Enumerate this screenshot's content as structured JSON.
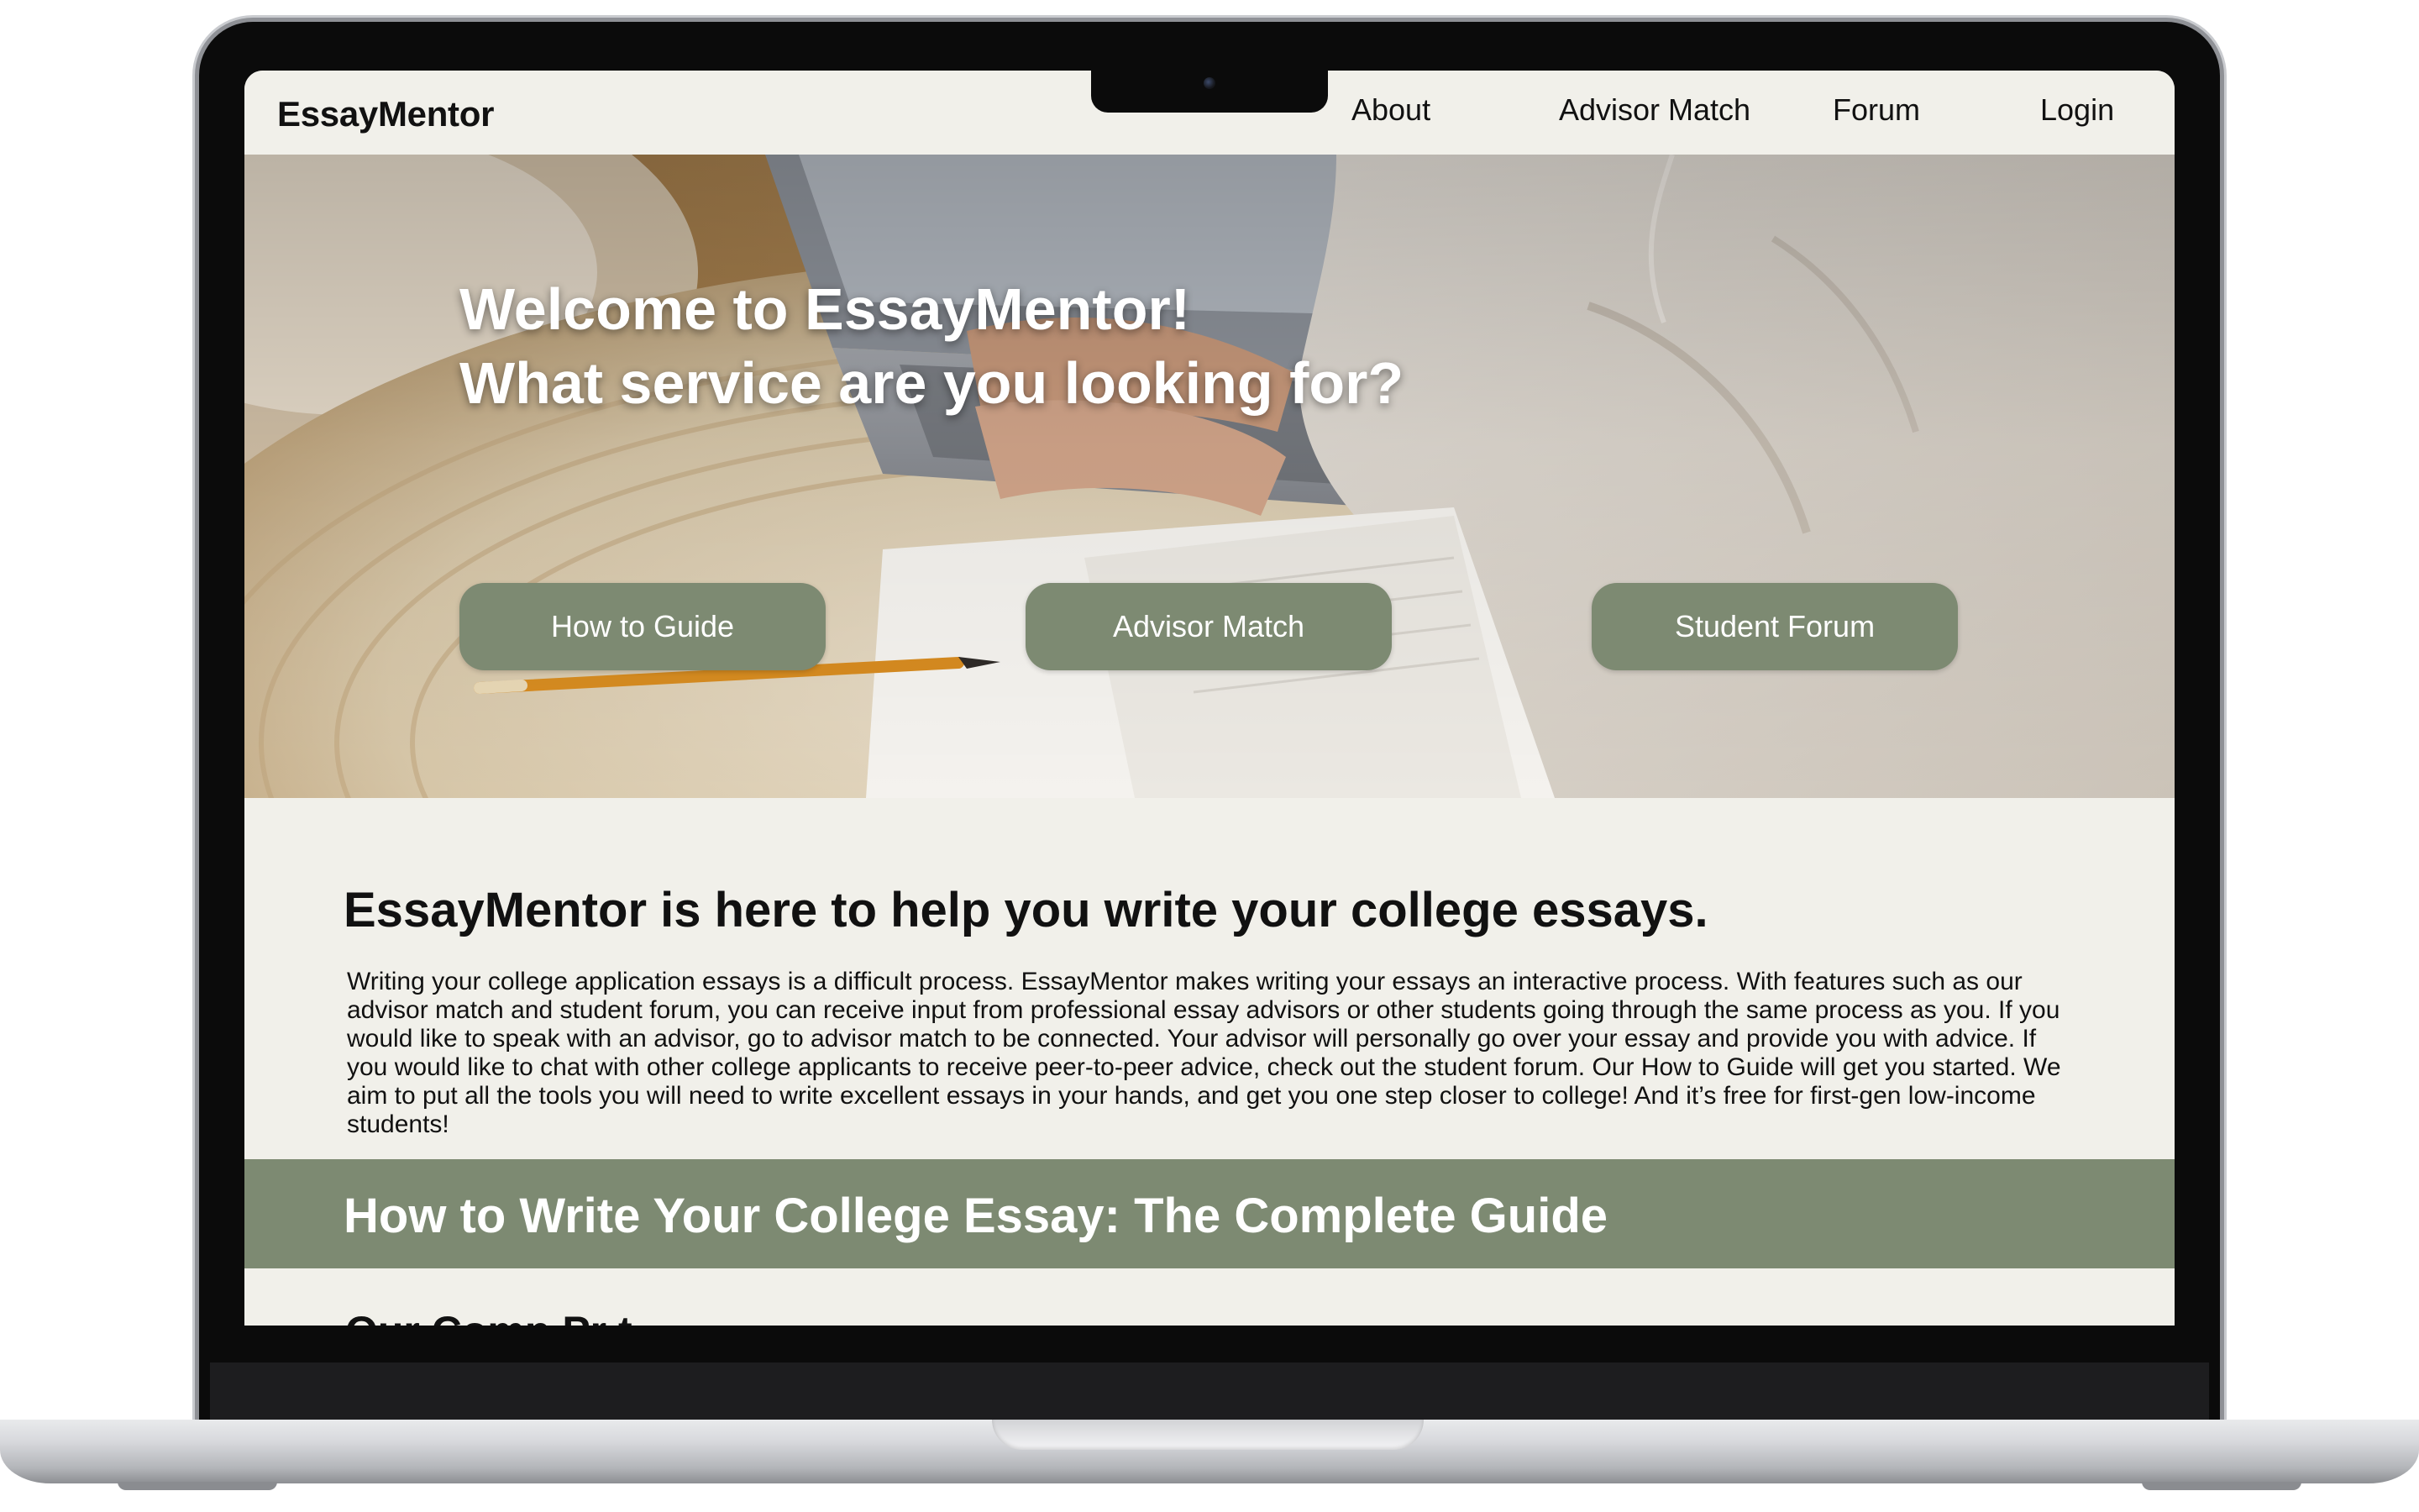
{
  "nav": {
    "brand": "EssayMentor",
    "links": [
      {
        "label": "About"
      },
      {
        "label": "Advisor Match"
      },
      {
        "label": "Forum"
      },
      {
        "label": "Login"
      }
    ]
  },
  "hero": {
    "title_line1": "Welcome to EssayMentor!",
    "title_line2": "What service are you looking for?",
    "buttons": [
      {
        "label": "How to Guide"
      },
      {
        "label": "Advisor Match"
      },
      {
        "label": "Student Forum"
      }
    ]
  },
  "intro": {
    "heading": "EssayMentor is here to help you write your college essays.",
    "body": "Writing your college application essays is a difficult process. EssayMentor makes writing your essays an interactive process. With features such as our advisor match and student forum, you can receive input from professional essay advisors or other students going through the same process as you. If you would like to speak with an advisor, go to advisor match to be connected. Your advisor will personally go over your essay and provide you with advice. If you would like to chat with other college applicants to receive peer-to-peer advice, check out the student forum. Our How to Guide will get you started. We aim to put all the tools you will need to write excellent essays in your hands, and get you one step closer to college! And it’s free for first-gen low-income students!"
  },
  "guide": {
    "title": "How to Write Your College Essay: The Complete Guide",
    "next_heading_partial": "Our             Comp     Pr          t"
  },
  "colors": {
    "accent_green": "#7d8a72",
    "page_background": "#f1f0ea",
    "text": "#111111"
  }
}
